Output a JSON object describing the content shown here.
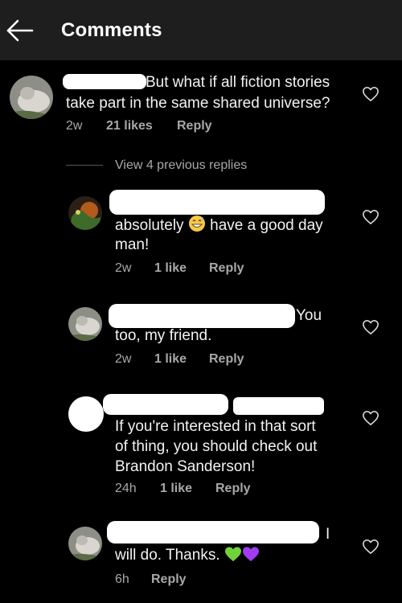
{
  "header": {
    "title": "Comments",
    "back_icon": "arrow-left-icon"
  },
  "colors": {
    "background": "#000000",
    "header": "#1e1e1e",
    "text": "#f2f2f2",
    "meta": "#a8a8a8"
  },
  "comments": [
    {
      "line1": "But what if all fiction stories",
      "line2": "take part in the same shared universe?",
      "time": "2w",
      "likes": "21 likes",
      "reply": "Reply"
    },
    {
      "view_replies": "View 4 previous replies"
    },
    {
      "line1a": "absolutely",
      "line1b": "have a good day",
      "line2": "man!",
      "emoji": "grinning-face-with-sweat",
      "time": "2w",
      "likes": "1 like",
      "reply": "Reply"
    },
    {
      "line1": "You",
      "line2": "too, my friend.",
      "time": "2w",
      "likes": "1 like",
      "reply": "Reply"
    },
    {
      "line1": "If you're interested in that sort",
      "line2": "of thing, you should check out",
      "line3": "Brandon Sanderson!",
      "time": "24h",
      "likes": "1 like",
      "reply": "Reply"
    },
    {
      "line1": "I",
      "line2": "will do. Thanks.",
      "emoji": "green-heart purple-heart",
      "time": "6h",
      "reply": "Reply"
    }
  ]
}
